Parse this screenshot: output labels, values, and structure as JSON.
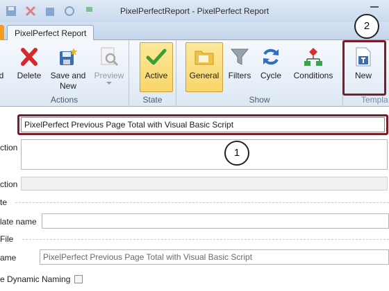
{
  "window": {
    "title": "PixelPerfectReport - PixelPerfect Report"
  },
  "ribbon_tab": "PixelPerfect Report",
  "groups": {
    "actions": {
      "label": "Actions",
      "buttons": {
        "load_partial": "d",
        "delete": "Delete",
        "save_new_1": "Save and",
        "save_new_2": "New",
        "preview": "Preview"
      }
    },
    "state": {
      "label": "State",
      "active": "Active"
    },
    "show": {
      "label": "Show",
      "general": "General",
      "filters": "Filters",
      "cycle": "Cycle",
      "conditions": "Conditions"
    },
    "template": {
      "label": "Templa",
      "new": "New"
    }
  },
  "callouts": {
    "one": "1",
    "two": "2"
  },
  "form": {
    "name_value": "PixelPerfect Previous Page Total with Visual Basic Script",
    "description_label": "ction",
    "description_value": "",
    "criteria_label": "ction",
    "criteria_value": "",
    "section_template": "te",
    "template_name_label": "late name",
    "template_name_value": "",
    "section_file": "File",
    "file_name_label": "ame",
    "file_name_value": "PixelPerfect Previous Page Total with Visual Basic Script",
    "dynamic_naming_label": "e Dynamic Naming",
    "dynamic_naming_checked": false
  }
}
